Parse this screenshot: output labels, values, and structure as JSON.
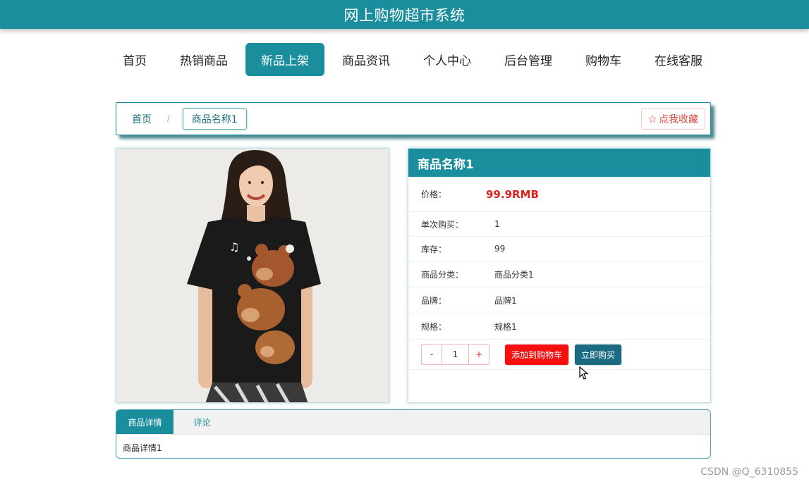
{
  "header": {
    "title": "网上购物超市系统",
    "brand_color": "#1b8e9e"
  },
  "nav": {
    "items": [
      {
        "label": "首页",
        "active": false
      },
      {
        "label": "热销商品",
        "active": false
      },
      {
        "label": "新品上架",
        "active": true
      },
      {
        "label": "商品资讯",
        "active": false
      },
      {
        "label": "个人中心",
        "active": false
      },
      {
        "label": "后台管理",
        "active": false
      },
      {
        "label": "购物车",
        "active": false
      },
      {
        "label": "在线客服",
        "active": false
      }
    ]
  },
  "breadcrumb": {
    "home": "首页",
    "separator": "/",
    "current": "商品名称1",
    "favorite_icon": "star-outline-icon",
    "favorite_label": "点我收藏"
  },
  "product": {
    "image": "woman-black-tshirt-bear-print",
    "name": "商品名称1",
    "rows": [
      {
        "key": "价格：",
        "value": "99.9RMB"
      },
      {
        "key": "单次购买：",
        "value": "1"
      },
      {
        "key": "库存：",
        "value": "99"
      },
      {
        "key": "商品分类：",
        "value": "商品分类1"
      },
      {
        "key": "品牌：",
        "value": "品牌1"
      },
      {
        "key": "规格：",
        "value": "规格1"
      }
    ],
    "quantity": {
      "minus": "-",
      "value": "1",
      "plus": "+"
    },
    "add_to_cart": "添加到购物车",
    "buy_now": "立即购买"
  },
  "tabs": {
    "items": [
      "商品详情",
      "评论"
    ],
    "active": 0,
    "content": "商品详情1"
  },
  "watermark": "CSDN @Q_6310855"
}
